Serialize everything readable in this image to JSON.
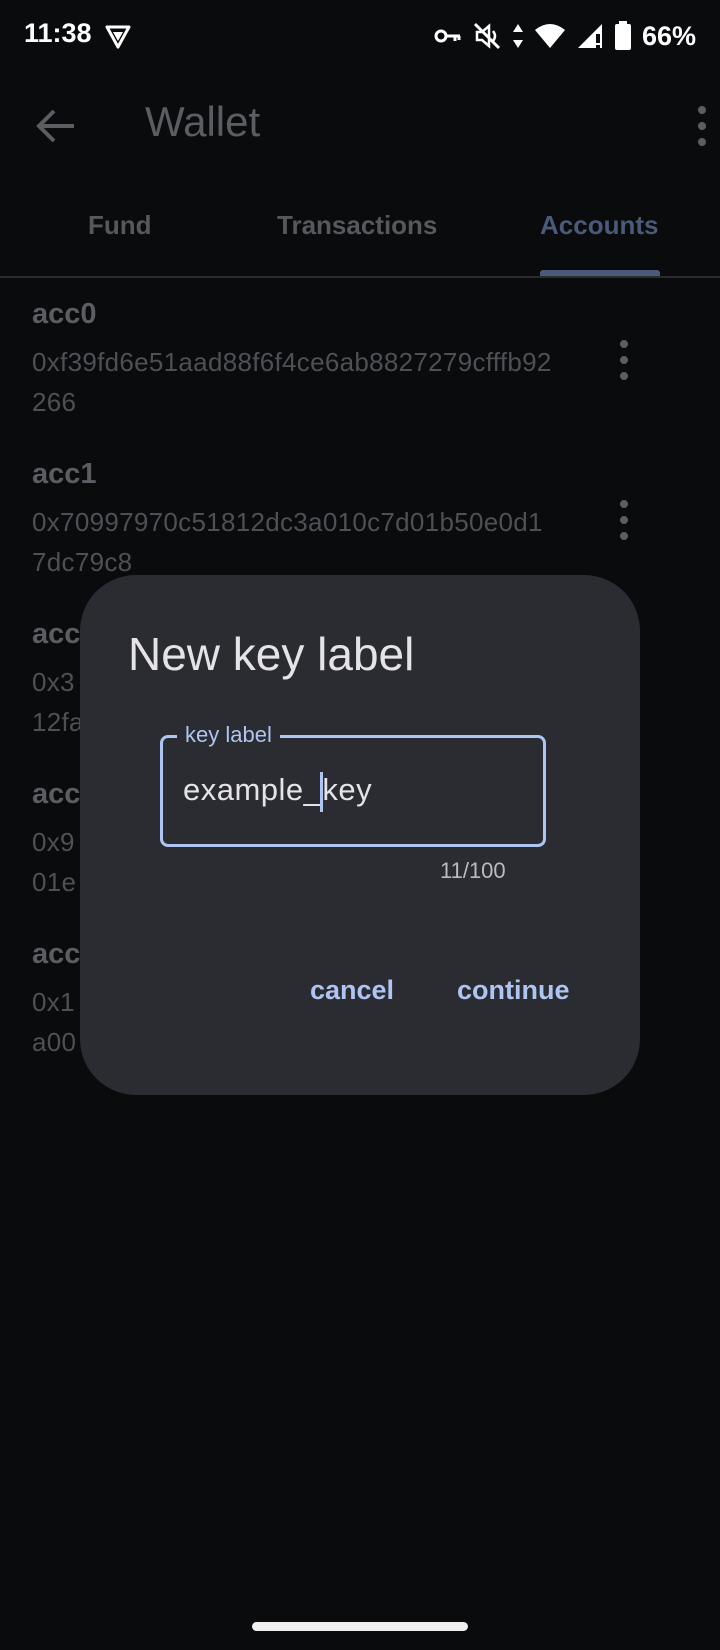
{
  "status_bar": {
    "time": "11:38",
    "battery": "66%",
    "icons": [
      "vpn-shield-icon",
      "key-icon",
      "mute-icon",
      "data-arrows-icon",
      "wifi-icon",
      "signal-icon",
      "battery-icon"
    ]
  },
  "app_bar": {
    "title": "Wallet",
    "back_icon": "arrow-left-icon",
    "overflow_icon": "more-vert-icon"
  },
  "tabs": [
    {
      "label": "Fund",
      "active": false
    },
    {
      "label": "Transactions",
      "active": false
    },
    {
      "label": "Accounts",
      "active": true
    }
  ],
  "accounts": [
    {
      "name": "acc0",
      "address": "0xf39fd6e51aad88f6f4ce6ab8827279cfffb92266"
    },
    {
      "name": "acc1",
      "address": "0x70997970c51812dc3a010c7d01b50e0d17dc79c8"
    },
    {
      "name": "acc",
      "address": "0x3",
      "address_line2": "12fa"
    },
    {
      "name": "acc",
      "address": "0x9",
      "address_line2": "01e"
    },
    {
      "name": "acc",
      "address": "0x1",
      "address_line2": "a00"
    }
  ],
  "dialog": {
    "title": "New key label",
    "field_label": "key label",
    "field_value_before_caret": "example_",
    "field_value_after_caret": "key",
    "counter": "11/100",
    "cancel_label": "cancel",
    "continue_label": "continue"
  },
  "colors": {
    "background": "#0a0b0d",
    "dialog": "#2b2c31",
    "accent": "#aec4f2"
  }
}
